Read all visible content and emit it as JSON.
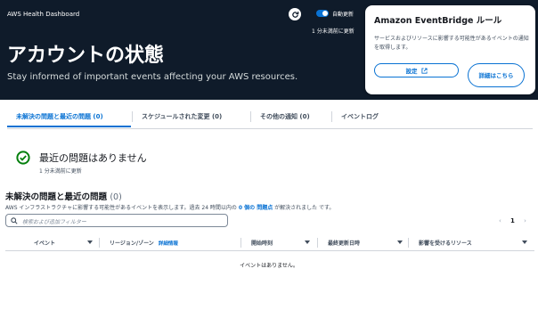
{
  "header": {
    "app_title": "AWS Health Dashboard",
    "page_title": "アカウントの状態",
    "subtitle": "Stay informed of important events affecting your AWS resources.",
    "auto_refresh_label": "自動更新",
    "auto_refresh_on": true,
    "last_updated": "1 分未満前に更新"
  },
  "eventbridge": {
    "title": "Amazon EventBridge ルール",
    "description": "サービスおよびリソースに影響する可能性があるイベントの通知を取得します。",
    "settings_button": "設定",
    "details_button": "詳細はこちら"
  },
  "tabs": [
    {
      "label": "未解決の問題と最近の問題 (0)",
      "active": true
    },
    {
      "label": "スケジュールされた変更 (0)",
      "active": false
    },
    {
      "label": "その他の通知 (0)",
      "active": false
    },
    {
      "label": "イベントログ",
      "active": false
    }
  ],
  "status": {
    "title": "最近の問題はありません",
    "updated": "1 分未満前に更新"
  },
  "issues": {
    "title": "未解決の問題と最近の問題",
    "count": "(0)",
    "desc_prefix": "AWS インフラストラクチャに影響する可能性があるイベントを表示します。過去 24 時間以内の",
    "desc_link": "0 個の 問題点",
    "desc_suffix": "が解決されました です。",
    "filter_placeholder": "検索および追加フィルター",
    "page": "1",
    "columns": [
      {
        "label": "イベント"
      },
      {
        "label": "リージョン/ゾーン",
        "info": "詳細情報"
      },
      {
        "label": "開始時刻"
      },
      {
        "label": "最終更新日時"
      },
      {
        "label": "影響を受けるリソース"
      }
    ],
    "empty_message": "イベントはありません。"
  },
  "colors": {
    "hero_bg": "#0f1b2a",
    "accent": "#0972d3",
    "success": "#037f0c"
  }
}
